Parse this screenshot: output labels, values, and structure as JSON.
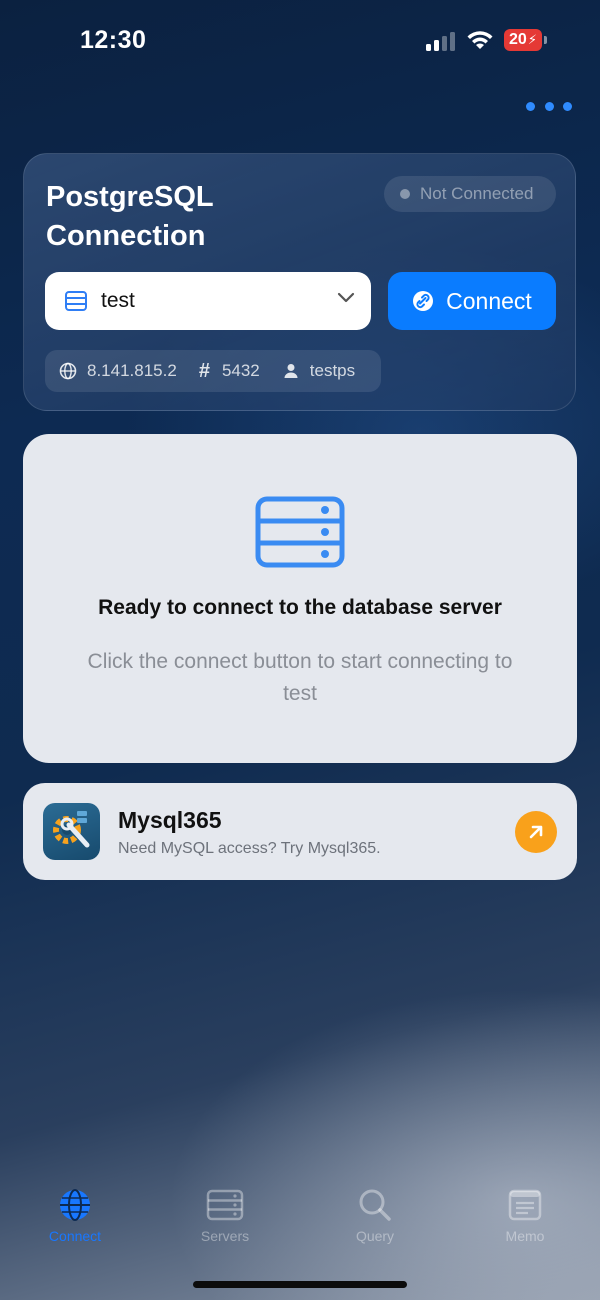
{
  "status_bar": {
    "time": "12:30",
    "battery": "20"
  },
  "colors": {
    "accent": "#0a7cff",
    "promo_accent": "#f9a11b"
  },
  "connection": {
    "title": "PostgreSQL Connection",
    "status": "Not Connected",
    "selected_server": "test",
    "connect_label": "Connect",
    "host": "8.141.815.2",
    "port": "5432",
    "user": "testps"
  },
  "ready": {
    "title": "Ready to connect to the database server",
    "subtitle": "Click the connect button to start connecting to test"
  },
  "promo": {
    "title": "Mysql365",
    "subtitle": "Need MySQL access? Try Mysql365."
  },
  "tabs": [
    {
      "label": "Connect",
      "icon": "globe-icon",
      "active": true
    },
    {
      "label": "Servers",
      "icon": "server-icon",
      "active": false
    },
    {
      "label": "Query",
      "icon": "search-icon",
      "active": false
    },
    {
      "label": "Memo",
      "icon": "memo-icon",
      "active": false
    }
  ]
}
